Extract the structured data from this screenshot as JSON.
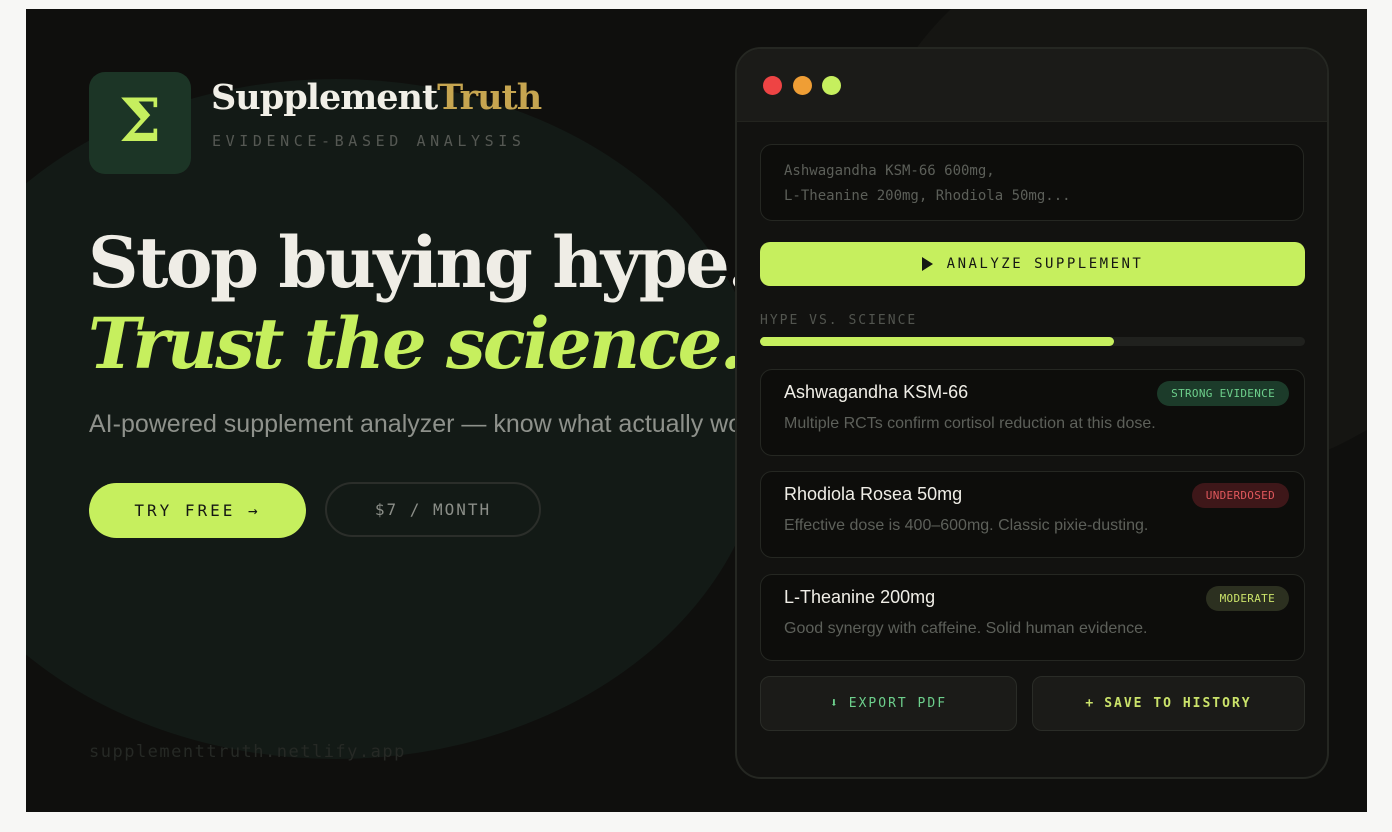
{
  "brand": {
    "logo_glyph": "Σ",
    "name_part1": "Supplement",
    "name_part2": "Truth",
    "tagline": "EVIDENCE-BASED ANALYSIS"
  },
  "hero": {
    "headline_line1": "Stop buying hype.",
    "headline_line2": "Trust the science.",
    "subheadline": "AI-powered supplement analyzer — know what actually works"
  },
  "cta": {
    "try_label": "TRY FREE →",
    "price_label": "$7 / MONTH"
  },
  "footer": {
    "url": "supplementtruth.netlify.app"
  },
  "app_window": {
    "input": {
      "line1": "Ashwagandha KSM-66 600mg,",
      "line2": "L-Theanine 200mg, Rhodiola 50mg..."
    },
    "analyze_label": "ANALYZE SUPPLEMENT",
    "meter": {
      "label": "HYPE VS. SCIENCE",
      "fill_fraction": 0.65
    },
    "results": [
      {
        "name": "Ashwagandha KSM-66",
        "badge": "STRONG EVIDENCE",
        "badge_type": "strong",
        "description": "Multiple RCTs confirm cortisol reduction at this dose."
      },
      {
        "name": "Rhodiola Rosea 50mg",
        "badge": "UNDERDOSED",
        "badge_type": "under",
        "description": "Effective dose is 400–600mg. Classic pixie-dusting."
      },
      {
        "name": "L-Theanine 200mg",
        "badge": "MODERATE",
        "badge_type": "moderate",
        "description": "Good synergy with caffeine. Solid human evidence."
      }
    ],
    "export_icon": "⬇",
    "export_label": "EXPORT PDF",
    "save_icon": "+",
    "save_label": "SAVE TO HISTORY"
  },
  "colors": {
    "accent": "#c6ef5e",
    "gold": "#c6a550",
    "background": "#0f0f0d",
    "dot_red": "#ee4444",
    "dot_orange": "#ef9e35",
    "dot_green": "#c6ef5e"
  }
}
